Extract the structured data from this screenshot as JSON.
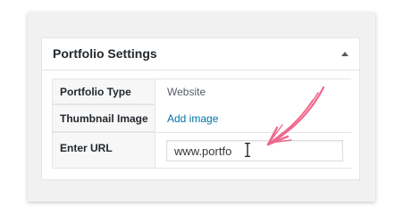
{
  "metabox": {
    "title": "Portfolio Settings",
    "toggle_icon": "triangle-up-icon"
  },
  "fields": [
    {
      "label": "Portfolio Type",
      "value": "Website"
    },
    {
      "label": "Thumbnail Image",
      "link": "Add image"
    },
    {
      "label": "Enter URL",
      "input_value": "www.portfo"
    }
  ],
  "colors": {
    "link": "#0073aa",
    "annotation_arrow": "#f0688c"
  }
}
